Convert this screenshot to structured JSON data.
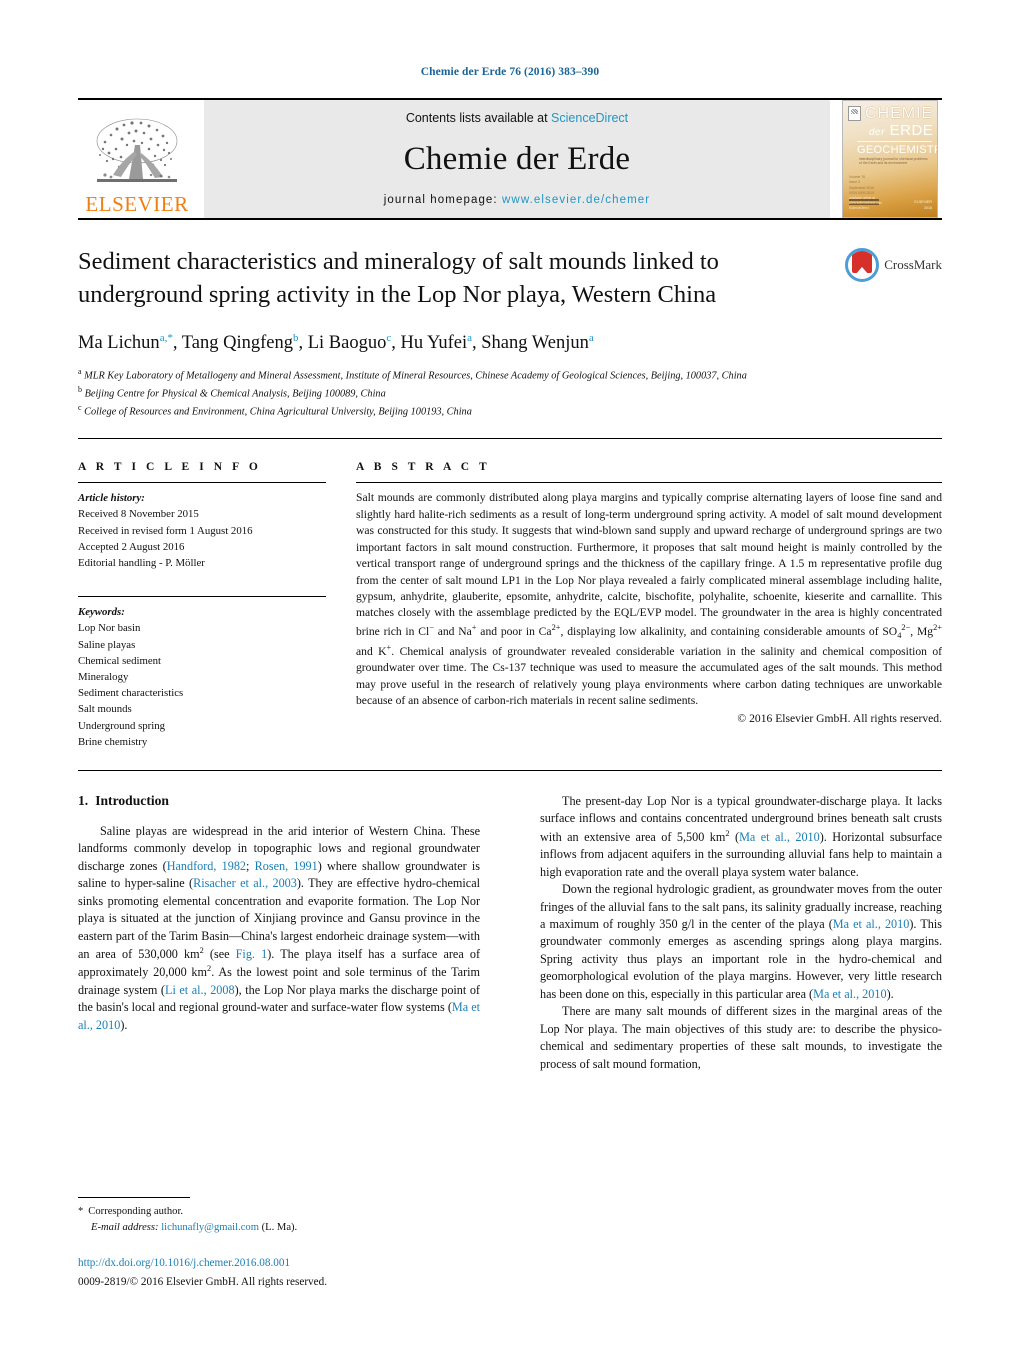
{
  "running_head": "Chemie der Erde 76 (2016) 383–390",
  "masthead": {
    "elsevier_wordmark": "ELSEVIER",
    "contents_prefix": "Contents lists available at ",
    "contents_link": "ScienceDirect",
    "journal_name": "Chemie der Erde",
    "homepage_prefix": "journal homepage: ",
    "homepage_url": "www.elsevier.de/chemer",
    "cover": {
      "line1": "CHEMIE",
      "line2_small": "der",
      "line2": "ERDE",
      "line3": "GEOCHEMISTRY",
      "line4": "interdisciplinary journal for chemical problems of the Earth and its environment",
      "block_a": "Volume 76\nIssue 3\nSeptember 2016\nISSN 0009-2819",
      "block_b": "Available online at\nwww.sciencedirect.com\nScienceDirect",
      "block_c": "ELSEVIER\n2016"
    }
  },
  "title": "Sediment characteristics and mineralogy of salt mounds linked to underground spring activity in the Lop Nor playa, Western China",
  "crossmark_label": "CrossMark",
  "authors": [
    {
      "name": "Ma Lichun",
      "marks": "a",
      "corresponding": true
    },
    {
      "name": "Tang Qingfeng",
      "marks": "b",
      "corresponding": false
    },
    {
      "name": "Li Baoguo",
      "marks": "c",
      "corresponding": false
    },
    {
      "name": "Hu Yufei",
      "marks": "a",
      "corresponding": false
    },
    {
      "name": "Shang Wenjun",
      "marks": "a",
      "corresponding": false
    }
  ],
  "affiliations": [
    {
      "mark": "a",
      "text": "MLR Key Laboratory of Metallogeny and Mineral Assessment, Institute of Mineral Resources, Chinese Academy of Geological Sciences, Beijing, 100037, China"
    },
    {
      "mark": "b",
      "text": "Beijing Centre for Physical & Chemical Analysis, Beijing 100089, China"
    },
    {
      "mark": "c",
      "text": "College of Resources and Environment, China Agricultural University, Beijing 100193, China"
    }
  ],
  "article_info": {
    "heading": "A R T I C L E   I N F O",
    "history_label": "Article history:",
    "history": [
      "Received 8 November 2015",
      "Received in revised form 1 August 2016",
      "Accepted 2 August 2016",
      "Editorial handling - P. Möller"
    ],
    "keywords_label": "Keywords:",
    "keywords": [
      "Lop Nor basin",
      "Saline playas",
      "Chemical sediment",
      "Mineralogy",
      "Sediment characteristics",
      "Salt mounds",
      "Underground spring",
      "Brine chemistry"
    ]
  },
  "abstract": {
    "heading": "A B S T R A C T",
    "paragraphs": [
      "Salt mounds are commonly distributed along playa margins and typically comprise alternating layers of loose fine sand and slightly hard halite-rich sediments as a result of long-term underground spring activity. A model of salt mound development was constructed for this study. It suggests that wind-blown sand supply and upward recharge of underground springs are two important factors in salt mound construction. Furthermore, it proposes that salt mound height is mainly controlled by the vertical transport range of underground springs and the thickness of the capillary fringe. A 1.5 m representative profile dug from the center of salt mound LP1 in the Lop Nor playa revealed a fairly complicated mineral assemblage including halite, gypsum, anhydrite, glauberite, epsomite, anhydrite, calcite, bischofite, polyhalite, schoenite, kieserite and carnallite. This matches closely with the assemblage predicted by the EQL/EVP model. The groundwater in the area is highly concentrated brine rich in Cl− and Na+ and poor in Ca2+, displaying low alkalinity, and containing considerable amounts of SO42−, Mg2+ and K+. Chemical analysis of groundwater revealed considerable variation in the salinity and chemical composition of groundwater over time. The Cs-137 technique was used to measure the accumulated ages of the salt mounds. This method may prove useful in the research of relatively young playa environments where carbon dating techniques are unworkable because of an absence of carbon-rich materials in recent saline sediments."
    ],
    "copyright": "© 2016 Elsevier GmbH. All rights reserved."
  },
  "section": {
    "number": "1.",
    "title": "Introduction"
  },
  "body": {
    "left_paragraphs": [
      "Saline playas are widespread in the arid interior of Western China. These landforms commonly develop in topographic lows and regional groundwater discharge zones (Handford, 1982; Rosen, 1991) where shallow groundwater is saline to hyper-saline (Risacher et al., 2003). They are effective hydro-chemical sinks promoting elemental concentration and evaporite formation. The Lop Nor playa is situated at the junction of Xinjiang province and Gansu province in the eastern part of the Tarim Basin—China's largest endorheic drainage system—with an area of 530,000 km2 (see Fig. 1). The playa itself has a surface area of approximately 20,000 km2. As the lowest point and sole terminus of the Tarim drainage system (Li et al., 2008), the Lop Nor playa marks the discharge point of the basin's local and regional ground-water and surface-water flow systems (Ma et al., 2010)."
    ],
    "right_paragraphs": [
      "The present-day Lop Nor is a typical groundwater-discharge playa. It lacks surface inflows and contains concentrated underground brines beneath salt crusts with an extensive area of 5,500 km2 (Ma et al., 2010). Horizontal subsurface inflows from adjacent aquifers in the surrounding alluvial fans help to maintain a high evaporation rate and the overall playa system water balance.",
      "Down the regional hydrologic gradient, as groundwater moves from the outer fringes of the alluvial fans to the salt pans, its salinity gradually increase, reaching a maximum of roughly 350 g/l in the center of the playa (Ma et al., 2010). This groundwater commonly emerges as ascending springs along playa margins. Spring activity thus plays an important role in the hydro-chemical and geomorphological evolution of the playa margins. However, very little research has been done on this, especially in this particular area (Ma et al., 2010).",
      "There are many salt mounds of different sizes in the marginal areas of the Lop Nor playa. The main objectives of this study are: to describe the physico-chemical and sedimentary properties of these salt mounds, to investigate the process of salt mound formation,"
    ]
  },
  "footnote": {
    "corresponding_mark": "*",
    "corresponding_text": "Corresponding author.",
    "email_label": "E-mail address:",
    "email": "lichunafly@gmail.com",
    "email_suffix": "(L. Ma).",
    "doi": "http://dx.doi.org/10.1016/j.chemer.2016.08.001",
    "issn": "0009-2819/© 2016 Elsevier GmbH. All rights reserved."
  },
  "colors": {
    "link": "#1a7fb5",
    "elsevier_orange": "#f07f12",
    "sciencedirect_blue": "#2196c4",
    "crossmark_red": "#d7302a",
    "crossmark_blue": "#4c9fd4"
  }
}
